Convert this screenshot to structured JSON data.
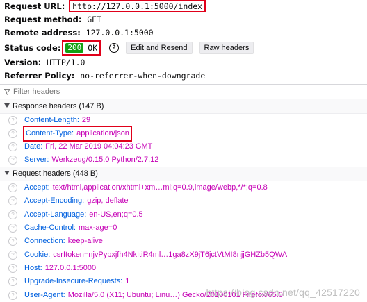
{
  "summary": {
    "request_url_key": "Request URL:",
    "request_url_value": "http://127.0.0.1:5000/index",
    "request_method_key": "Request method:",
    "request_method_value": "GET",
    "remote_address_key": "Remote address:",
    "remote_address_value": "127.0.0.1:5000",
    "status_code_key": "Status code:",
    "status_code": "200",
    "status_text": "OK",
    "edit_resend_label": "Edit and Resend",
    "raw_headers_label": "Raw headers",
    "version_key": "Version:",
    "version_value": "HTTP/1.0",
    "referrer_policy_key": "Referrer Policy:",
    "referrer_policy_value": "no-referrer-when-downgrade",
    "status_color": "#12a012"
  },
  "filter": {
    "placeholder": "Filter headers"
  },
  "response_headers": {
    "title": "Response headers (147 B)",
    "items": [
      {
        "name": "Content-Length:",
        "value": "29"
      },
      {
        "name": "Content-Type:",
        "value": "application/json"
      },
      {
        "name": "Date:",
        "value": "Fri, 22 Mar 2019 04:04:23 GMT"
      },
      {
        "name": "Server:",
        "value": "Werkzeug/0.15.0 Python/2.7.12"
      }
    ]
  },
  "request_headers": {
    "title": "Request headers (448 B)",
    "items": [
      {
        "name": "Accept:",
        "value": "text/html,application/xhtml+xm…ml;q=0.9,image/webp,*/*;q=0.8"
      },
      {
        "name": "Accept-Encoding:",
        "value": "gzip, deflate"
      },
      {
        "name": "Accept-Language:",
        "value": "en-US,en;q=0.5"
      },
      {
        "name": "Cache-Control:",
        "value": "max-age=0"
      },
      {
        "name": "Connection:",
        "value": "keep-alive"
      },
      {
        "name": "Cookie:",
        "value": "csrftoken=njvPypxjfh4NkItiR4ml…1ga8zX9jT6jctVtMI8njjGHZb5QWA"
      },
      {
        "name": "Host:",
        "value": "127.0.0.1:5000"
      },
      {
        "name": "Upgrade-Insecure-Requests:",
        "value": "1"
      },
      {
        "name": "User-Agent:",
        "value": "Mozilla/5.0 (X11; Ubuntu; Linu…) Gecko/20100101 Firefox/65.0"
      }
    ]
  },
  "watermark": "https://blog.csdn.net/qq_42517220",
  "colors": {
    "header_name": "#0060df",
    "header_value": "#c600b5",
    "highlight": "#e0001a"
  }
}
